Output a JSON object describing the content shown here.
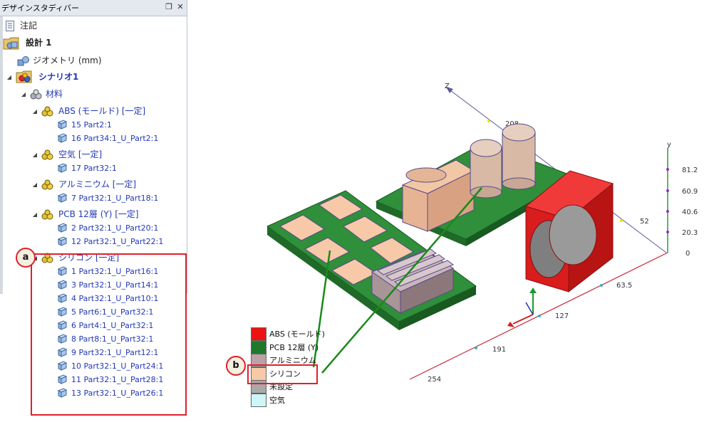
{
  "panel": {
    "title": "デザインスタディバー",
    "pin_glyph": "❐",
    "close_glyph": "✕"
  },
  "tree": {
    "notes": "注記",
    "design": "設計 1",
    "geometry": "ジオメトリ (mm)",
    "scenario": "シナリオ1",
    "materials": "材料",
    "groups": [
      {
        "label": "ABS (モールド) [一定]",
        "items": [
          "15 Part2:1",
          "16 Part34:1_U_Part2:1"
        ]
      },
      {
        "label": "空気 [一定]",
        "items": [
          "17 Part32:1"
        ]
      },
      {
        "label": "アルミニウム [一定]",
        "items": [
          "7 Part32:1_U_Part18:1"
        ]
      },
      {
        "label": "PCB 12層 (Y) [一定]",
        "items": [
          "2 Part32:1_U_Part20:1",
          "12 Part32:1_U_Part22:1"
        ]
      },
      {
        "label": "シリコン [一定]",
        "items": [
          "1 Part32:1_U_Part16:1",
          "3 Part32:1_U_Part14:1",
          "4 Part32:1_U_Part10:1",
          "5 Part6:1_U_Part32:1",
          "6 Part4:1_U_Part32:1",
          "8 Part8:1_U_Part32:1",
          "9 Part32:1_U_Part12:1",
          "10 Part32:1_U_Part24:1",
          "11 Part32:1_U_Part28:1",
          "13 Part32:1_U_Part26:1"
        ]
      }
    ]
  },
  "callouts": {
    "a": "a",
    "b": "b"
  },
  "axes": {
    "z_label": "Z",
    "y_label": "y",
    "z_tick": "208",
    "y_ticks": [
      "81.2",
      "60.9",
      "40.6",
      "20.3",
      "0"
    ],
    "y_side_tick": "52",
    "x_ticks": [
      "63.5",
      "127",
      "191",
      "254"
    ]
  },
  "legend": [
    {
      "label": "ABS (モールド)",
      "color": "#ee1111"
    },
    {
      "label": "PCB 12層 (Y)",
      "color": "#1e7a2a"
    },
    {
      "label": "アルミニウム",
      "color": "#b9a3a6"
    },
    {
      "label": "シリコン",
      "color": "#f7c9a8"
    },
    {
      "label": "未設定",
      "color": "#a9a9a9"
    },
    {
      "label": "空気",
      "color": "#ccf6f8"
    }
  ],
  "colors": {
    "tree_blue": "#2238b8",
    "highlight_red": "#e0202a",
    "pcb_green": "#2f8f3a",
    "silicon": "#f7c9a8",
    "abs_red": "#e81010",
    "cap_tan": "#d7b9a6"
  }
}
